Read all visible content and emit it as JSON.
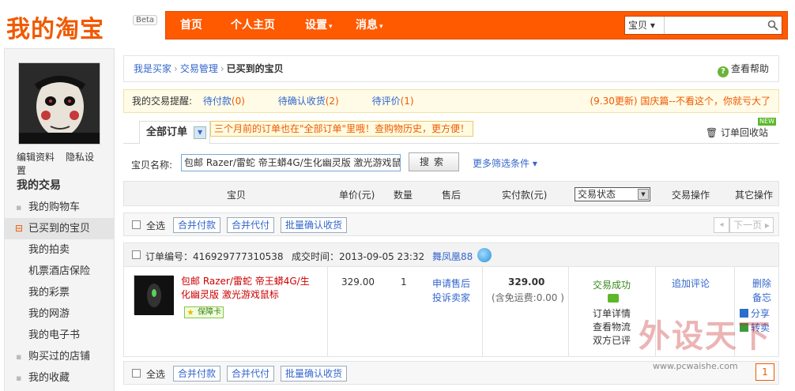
{
  "header": {
    "logo": "我的淘宝",
    "beta": "Beta",
    "nav": [
      {
        "label": "首页"
      },
      {
        "label": "个人主页"
      },
      {
        "label": "设置",
        "caret": "▾"
      },
      {
        "label": "消息",
        "caret": "▾"
      }
    ],
    "search": {
      "category": "宝贝 ▾",
      "placeholder": ""
    }
  },
  "sidebar": {
    "edit_profile": "编辑资料",
    "privacy": "隐私设置",
    "section_title": "我的交易",
    "items": [
      {
        "label": "我的购物车"
      },
      {
        "label": "已买到的宝贝"
      },
      {
        "label": "我的拍卖"
      },
      {
        "label": "机票酒店保险"
      },
      {
        "label": "我的彩票"
      },
      {
        "label": "我的网游"
      },
      {
        "label": "我的电子书"
      },
      {
        "label": "购买过的店铺"
      },
      {
        "label": "我的收藏"
      }
    ]
  },
  "breadcrumb": {
    "items": [
      "我是买家",
      "交易管理",
      "已买到的宝贝"
    ],
    "sep": "›",
    "help": "查看帮助",
    "help_icon": "?"
  },
  "reminder": {
    "label": "我的交易提醒:",
    "pending_pay": {
      "label": "待付款",
      "count": "(0)"
    },
    "pending_confirm": {
      "label": "待确认收货",
      "count": "(2)"
    },
    "pending_review": {
      "label": "待评价",
      "count": "(1)"
    },
    "promo": "(9.30更新) 国庆篇--不看这个，你就亏大了"
  },
  "tabs": {
    "all_orders": "全部订单",
    "tip": "三个月前的订单也在\"全部订单\"里哦！查购物历史，更方便！",
    "recycle": "订单回收站",
    "new_badge": "NEW"
  },
  "filter": {
    "label": "宝贝名称:",
    "value": "包邮 Razer/雷蛇 帝王蟒4G/生化幽灵版 激光游戏鼠",
    "search_button": "搜索",
    "more": "更多筛选条件 ▾"
  },
  "table": {
    "headers": [
      "宝贝",
      "单价(元)",
      "数量",
      "售后",
      "实付款(元)",
      "交易操作",
      "其它操作"
    ],
    "status_select": "交易状态"
  },
  "batch": {
    "select_all": "全选",
    "merge_pay": "合并付款",
    "merge_proxy": "合并代付",
    "batch_confirm": "批量确认收货",
    "prev": "◂",
    "next": "下一页 ▸"
  },
  "order": {
    "order_no": "订单编号：416929777310538",
    "time": "成交时间：2013-09-05 23:32",
    "seller": "舞凤凰88",
    "title": "包邮 Razer/雷蛇 帝王蟒4G/生化幽灵版 激光游戏鼠标",
    "insurance": "保障卡",
    "price": "329.00",
    "qty": "1",
    "after_sale": [
      "申请售后",
      "投诉卖家"
    ],
    "paid": "329.00",
    "shipping": "(含免运费:0.00 )",
    "status": "交易成功",
    "status_links": [
      "订单详情",
      "查看物流",
      "双方已评"
    ],
    "ops": "追加评论",
    "other_ops": [
      "删除",
      "备忘",
      "分享",
      "转卖"
    ]
  },
  "watermark": {
    "text": "外设天下",
    "url": "www.pcwaishe.com"
  },
  "page_num": "1",
  "colors": {
    "accent": "#ff5a00",
    "link": "#3366cc",
    "alert": "#cc0000"
  }
}
